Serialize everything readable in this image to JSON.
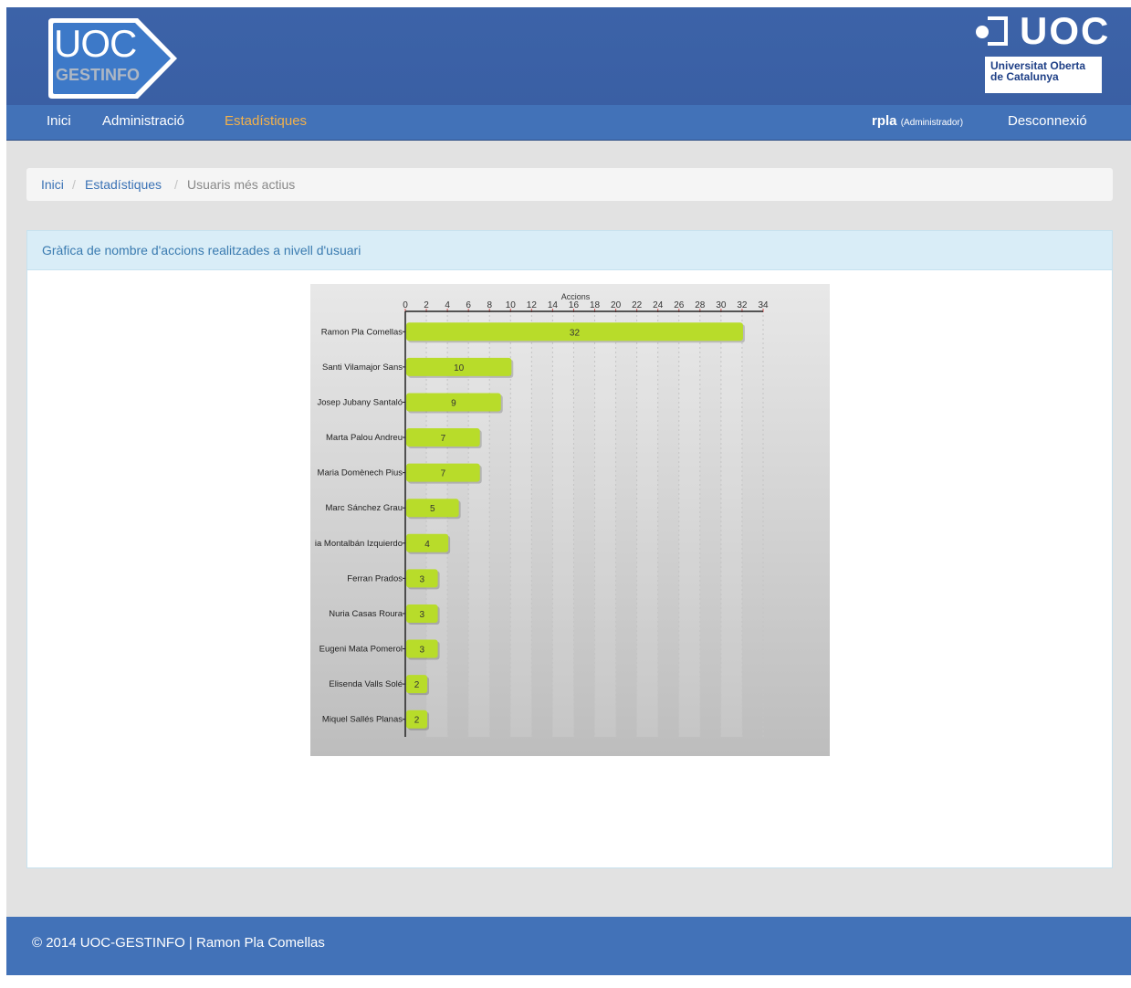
{
  "header": {
    "logo_title": "UOC",
    "logo_subtitle": "GESTINFO",
    "brand_word": "UOC",
    "brand_line1": "Universitat Oberta",
    "brand_line2": "de Catalunya"
  },
  "nav": {
    "items": [
      "Inici",
      "Administració",
      "Estadístiques"
    ],
    "active_index": 2,
    "user": "rpla",
    "role": "(Administrador)",
    "logout": "Desconnexió"
  },
  "breadcrumb": {
    "items": [
      "Inici",
      "Estadístiques",
      "Usuaris més actius"
    ],
    "separator": "/"
  },
  "panel": {
    "title": "Gràfica de nombre d'accions realitzades a nivell d'usuari"
  },
  "chart_data": {
    "type": "bar",
    "orientation": "horizontal",
    "xlabel": "Accions",
    "xlim": [
      0,
      34
    ],
    "xticks": [
      0,
      2,
      4,
      6,
      8,
      10,
      12,
      14,
      16,
      18,
      20,
      22,
      24,
      26,
      28,
      30,
      32,
      34
    ],
    "grid": true,
    "categories": [
      "Ramon Pla Comellas",
      "Santi Vilamajor Sans",
      "Josep Jubany Santaló",
      "Marta Palou Andreu",
      "Maria Domènech Pius",
      "Marc Sánchez Grau",
      "ia Montalbán Izquierdo",
      "Ferran Prados",
      "Nuria Casas Roura",
      "Eugeni Mata Pomerol",
      "Elisenda Valls Solé",
      "Miquel Sallés Planas"
    ],
    "values": [
      32,
      10,
      9,
      7,
      7,
      5,
      4,
      3,
      3,
      3,
      2,
      2
    ],
    "bar_color": "#b8dc2a"
  },
  "footer": {
    "text": "© 2014 UOC-GESTINFO | Ramon Pla Comellas"
  }
}
